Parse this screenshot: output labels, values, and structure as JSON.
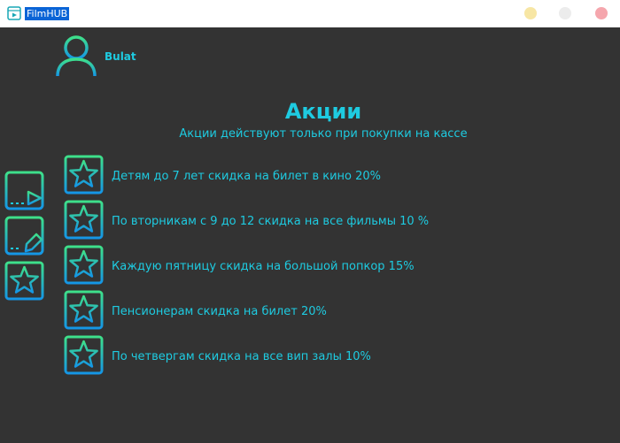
{
  "window": {
    "title": "FilmHUB"
  },
  "user": {
    "name": "Bulat"
  },
  "page": {
    "title": "Акции",
    "subtitle": "Акции действуют только при покупки на кассе"
  },
  "sidebar": {
    "items": [
      {
        "icon": "film-play-icon"
      },
      {
        "icon": "film-edit-icon"
      },
      {
        "icon": "star-icon"
      }
    ]
  },
  "promotions": [
    {
      "text": "Детям до 7 лет скидка на билет в кино 20%"
    },
    {
      "text": "По вторникам с 9 до 12 скидка на все фильмы 10 %"
    },
    {
      "text": "Каждую пятницу скидка на большой попкор 15%"
    },
    {
      "text": "Пенсионерам скидка на билет 20%"
    },
    {
      "text": "По четвергам скидка на все вип залы 10%"
    }
  ],
  "colors": {
    "background": "#333333",
    "accent_cyan": "#1ecbe1",
    "accent_green": "#3ee08a",
    "accent_blue": "#1596e6"
  }
}
